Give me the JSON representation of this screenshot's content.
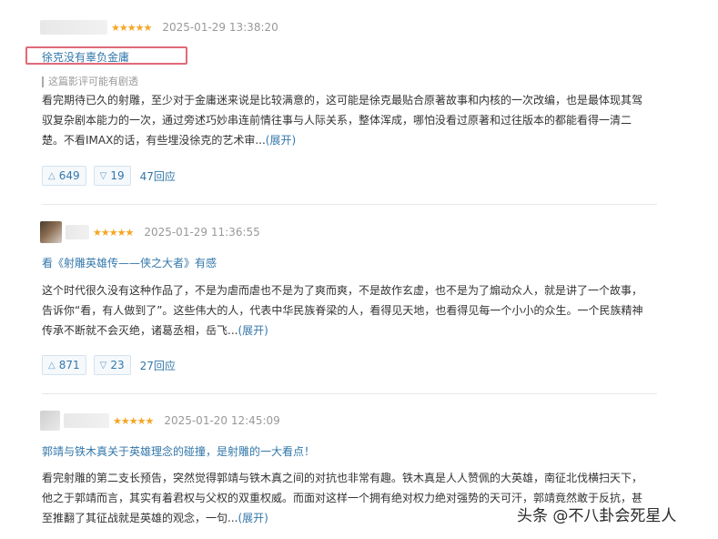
{
  "reviews": [
    {
      "stars": "★★★★★",
      "time": "2025-01-29 13:38:20",
      "title": "徐克没有辜负金庸",
      "spoiler_note": "这篇影评可能有剧透",
      "body": "看完期待已久的射雕，至少对于金庸迷来说是比较满意的，这可能是徐克最贴合原著故事和内核的一次改编，也是最体现其驾驭复杂剧本能力的一次，通过旁述巧妙串连前情往事与人际关系，整体浑成，哪怕没看过原著和过往版本的都能看得一清二楚。不看IMAX的话，有些埋没徐克的艺术审...",
      "expand": "(展开)",
      "up_count": "649",
      "down_count": "19",
      "replies": "47回应"
    },
    {
      "stars": "★★★★★",
      "time": "2025-01-29 11:36:55",
      "title": "看《射雕英雄传——侠之大者》有感",
      "body": "这个时代很久没有这种作品了，不是为虐而虐也不是为了爽而爽，不是故作玄虚，也不是为了煽动众人，就是讲了一个故事，告诉你“看，有人做到了”。这些伟大的人，代表中华民族脊梁的人，看得见天地，也看得见每一个小小的众生。一个民族精神传承不断就不会灭绝，诸葛丞相，岳飞...",
      "expand": "(展开)",
      "up_count": "871",
      "down_count": "23",
      "replies": "27回应"
    },
    {
      "stars": "★★★★★",
      "time": "2025-01-20 12:45:09",
      "title": "郭靖与铁木真关于英雄理念的碰撞，是射雕的一大看点！",
      "body": "看完射雕的第二支长预告，突然觉得郭靖与铁木真之间的对抗也非常有趣。铁木真是人人赞佩的大英雄，南征北伐横扫天下，他之于郭靖而言，其实有着君权与父权的双重权威。而面对这样一个拥有绝对权力绝对强势的天可汗，郭靖竟然敢于反抗，甚至推翻了其征战就是英雄的观念，一句...",
      "expand": "(展开)"
    }
  ],
  "icons": {
    "up": "triangle-up-icon",
    "down": "triangle-down-icon"
  },
  "watermark": "头条 @不八卦会死星人",
  "colors": {
    "link": "#3377aa",
    "star": "#f5a623",
    "highlight_box": "#e06a78"
  }
}
